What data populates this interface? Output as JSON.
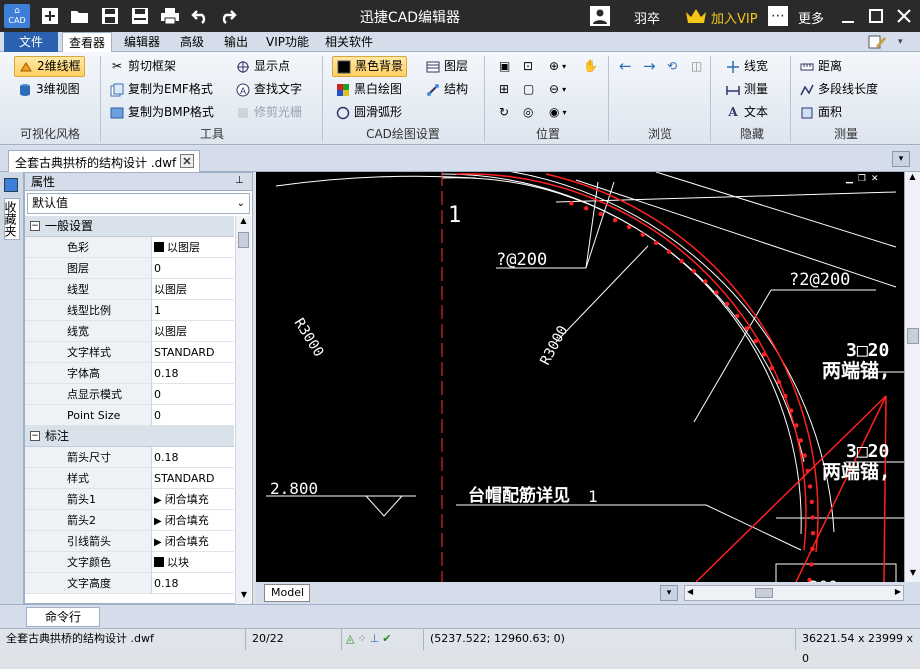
{
  "app": {
    "title": "迅捷CAD编辑器",
    "logo_text": "CAD",
    "user_name": "羽卒",
    "vip_label": "加入VIP",
    "more_label": "更多"
  },
  "menu": {
    "file": "文件",
    "tabs": [
      "查看器",
      "编辑器",
      "高级",
      "输出",
      "VIP功能",
      "相关软件"
    ]
  },
  "ribbon": {
    "visual": {
      "wireframe_2d": "2维线框",
      "view_3d": "3维视图",
      "group": "可视化风格"
    },
    "tools": {
      "clip_frame": "剪切框架",
      "copy_emf": "复制为EMF格式",
      "copy_bmp": "复制为BMP格式",
      "show_points": "显示点",
      "find_text": "查找文字",
      "trim_raster": "修剪光栅",
      "group": "工具"
    },
    "cad_settings": {
      "black_bg": "黑色背景",
      "bw_draw": "黑白绘图",
      "smooth_arc": "圆滑弧形",
      "layers": "图层",
      "structure": "结构",
      "group": "CAD绘图设置"
    },
    "position": {
      "group": "位置"
    },
    "browse": {
      "group": "浏览"
    },
    "hide": {
      "line_width": "线宽",
      "measure": "测量",
      "text": "文本",
      "group": "隐藏"
    },
    "measure": {
      "distance": "距离",
      "polyline_length": "多段线长度",
      "area": "面积",
      "group": "测量"
    }
  },
  "document": {
    "tab_title": "全套古典拱桥的结构设计 .dwf"
  },
  "sidebar": {
    "favorites": "收藏夹"
  },
  "properties": {
    "title": "属性",
    "pin": "ᵖ",
    "dropdown_value": "默认值",
    "sections": [
      {
        "name": "一般设置",
        "rows": [
          {
            "name": "色彩",
            "value": "以图层",
            "swatch": "#000000"
          },
          {
            "name": "图层",
            "value": "0"
          },
          {
            "name": "线型",
            "value": "以图层"
          },
          {
            "name": "线型比例",
            "value": "1"
          },
          {
            "name": "线宽",
            "value": "以图层"
          },
          {
            "name": "文字样式",
            "value": "STANDARD"
          },
          {
            "name": "字体高",
            "value": "0.18"
          },
          {
            "name": "点显示模式",
            "value": "0"
          },
          {
            "name": "Point Size",
            "value": "0"
          }
        ]
      },
      {
        "name": "标注",
        "rows": [
          {
            "name": "箭头尺寸",
            "value": "0.18"
          },
          {
            "name": "样式",
            "value": "STANDARD"
          },
          {
            "name": "箭头1",
            "value": "闭合填充",
            "arrow": true
          },
          {
            "name": "箭头2",
            "value": "闭合填充",
            "arrow": true
          },
          {
            "name": "引线箭头",
            "value": "闭合填充",
            "arrow": true
          },
          {
            "name": "文字颜色",
            "value": "以块",
            "swatch": "#000000"
          },
          {
            "name": "文字高度",
            "value": "0.18"
          }
        ]
      }
    ]
  },
  "drawing": {
    "labels": {
      "l1": "1",
      "rebar1": "?@200",
      "rebar2": "?2@200",
      "r1": "R3000",
      "r2": "R3000",
      "bar3a": "3□20",
      "anchor_a": "两端锚,",
      "bar3b": "3□20",
      "anchor_b": "两端锚,",
      "elev": "2.800",
      "detail": "台帽配筋详见",
      "detail_no": "1",
      "cut": "200"
    },
    "colors": {
      "line": "#ffffff",
      "rebar": "#ff2020",
      "background": "#000000"
    }
  },
  "bottom": {
    "model_tab": "Model",
    "command_tab": "命令行"
  },
  "status": {
    "file": "全套古典拱桥的结构设计 .dwf",
    "page": "20/22",
    "coords": "(5237.522; 12960.63; 0)",
    "size": "36221.54 x 23999 x 0"
  }
}
